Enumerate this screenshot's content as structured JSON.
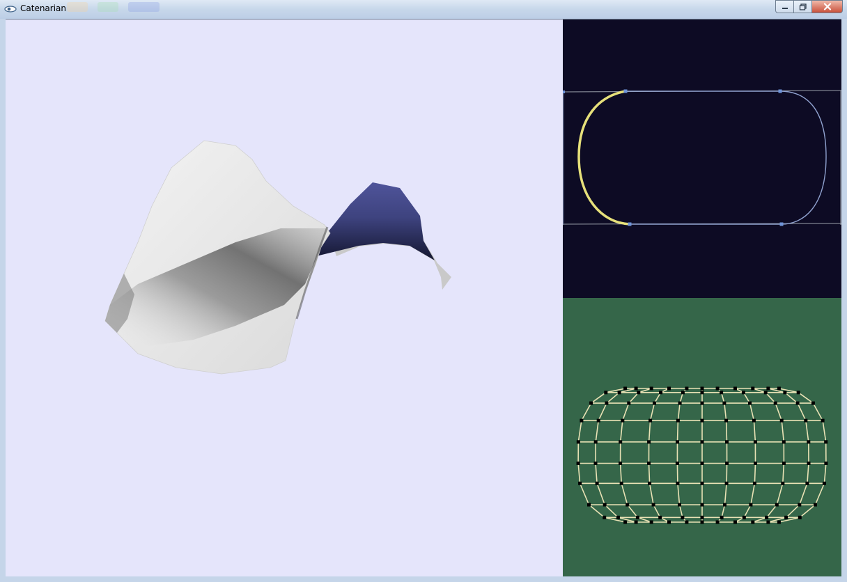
{
  "window": {
    "title": "Catenarian",
    "app_icon": "eye-icon",
    "controls": {
      "minimize_icon": "minimize-icon",
      "maximize_icon": "maximize-icon",
      "close_icon": "close-icon"
    }
  },
  "views": {
    "surface_3d": {
      "background": "#e5e5fb",
      "surface_light": "#f2f2f2",
      "surface_shadow": "#5a5a5a",
      "surface_accent": "#454a8e"
    },
    "profile_curve": {
      "background": "#0d0b24",
      "highlight_color": "#e6e07a",
      "curve_color": "#90a2cf",
      "guide_color": "#9aa0aa",
      "handle_color": "#6f94d9"
    },
    "mesh_grid": {
      "background": "#356649",
      "line_color": "#e9e2b5",
      "vertex_color": "#000000"
    }
  }
}
